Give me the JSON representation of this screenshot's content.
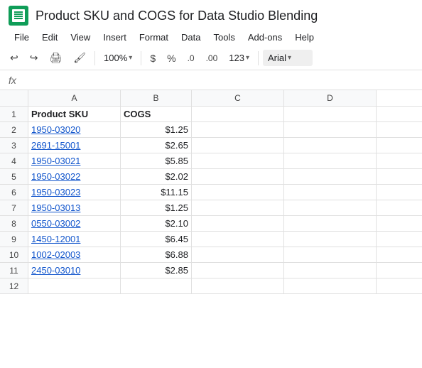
{
  "title": "Product SKU and COGS for Data Studio Blending",
  "menu": {
    "items": [
      "File",
      "Edit",
      "View",
      "Insert",
      "Format",
      "Data",
      "Tools",
      "Add-ons",
      "Help"
    ]
  },
  "toolbar": {
    "zoom": "100%",
    "zoom_arrow": "▾",
    "dollar": "$",
    "percent": "%",
    "decimal_less": ".0",
    "decimal_more": ".00",
    "number_format": "123",
    "font": "Arial",
    "font_arrow": "▾"
  },
  "columns": {
    "headers": [
      "A",
      "B",
      "C",
      "D"
    ],
    "widths": [
      130,
      100,
      130,
      130
    ]
  },
  "rows": [
    {
      "num": 1,
      "a": "Product SKU",
      "b": "COGS",
      "header": true
    },
    {
      "num": 2,
      "a": "1950-03020",
      "b": "$1.25"
    },
    {
      "num": 3,
      "a": "2691-15001",
      "b": "$2.65"
    },
    {
      "num": 4,
      "a": "1950-03021",
      "b": "$5.85"
    },
    {
      "num": 5,
      "a": "1950-03022",
      "b": "$2.02"
    },
    {
      "num": 6,
      "a": "1950-03023",
      "b": "$11.15"
    },
    {
      "num": 7,
      "a": "1950-03013",
      "b": "$1.25"
    },
    {
      "num": 8,
      "a": "0550-03002",
      "b": "$2.10"
    },
    {
      "num": 9,
      "a": "1450-12001",
      "b": "$6.45"
    },
    {
      "num": 10,
      "a": "1002-02003",
      "b": "$6.88"
    },
    {
      "num": 11,
      "a": "2450-03010",
      "b": "$2.85"
    },
    {
      "num": 12,
      "a": "",
      "b": ""
    }
  ],
  "colors": {
    "sku_link": "#1155cc",
    "header_bg": "#f8f9fa",
    "border": "#e0e0e0",
    "icon_green": "#0f9d58"
  }
}
